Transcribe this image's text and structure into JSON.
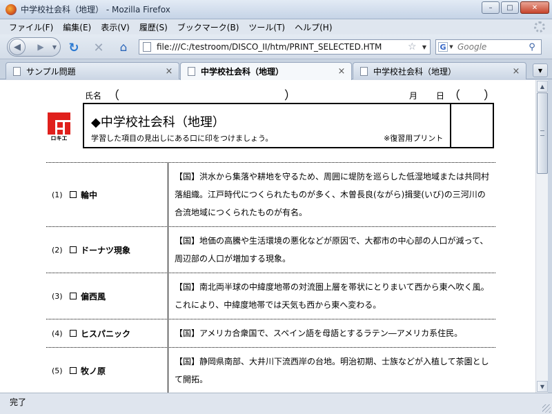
{
  "window": {
    "title": "中学校社会科（地理）  - Mozilla Firefox",
    "buttons": [
      "–",
      "□",
      "✕"
    ]
  },
  "menu": [
    "ファイル(F)",
    "編集(E)",
    "表示(V)",
    "履歴(S)",
    "ブックマーク(B)",
    "ツール(T)",
    "ヘルプ(H)"
  ],
  "nav": {
    "url": "file:///C:/testroom/DISCO_II/htm/PRINT_SELECTED.HTM",
    "search_placeholder": "Google",
    "search_engine_glyph": "G",
    "icons": [
      "back-icon",
      "forward-icon",
      "reload-icon",
      "stop-icon",
      "home-icon",
      "star-icon",
      "search-icon"
    ]
  },
  "tabs": [
    {
      "label": "サンプル問題",
      "close": "×"
    },
    {
      "label": "中学校社会科（地理）",
      "close": "×",
      "active": true
    },
    {
      "label": "中学校社会科（地理）",
      "close": "×"
    }
  ],
  "page": {
    "name_label": "氏名",
    "paren_open": "（",
    "paren_close": "）",
    "month_label": "月",
    "day_label": "日",
    "logo_text": "ロキエ",
    "subject_title": "◆中学校社会科（地理）",
    "instruction": "学習した項目の見出しにある口に印をつけましょう。",
    "review_note": "※復習用プリント",
    "terms": [
      {
        "num": "(1)",
        "word": "輪中",
        "def": "【国】洪水から集落や耕地を守るため、周囲に堤防を巡らした低湿地域または共同村落組織。江戸時代につくられたものが多く、木曽長良(ながら)揖斐(いび)の三河川の合流地域につくられたものが有名。"
      },
      {
        "num": "(2)",
        "word": "ドーナツ現象",
        "def": "【国】地価の高騰や生活環境の悪化などが原因で、大都市の中心部の人口が減って、周辺部の人口が増加する現象。"
      },
      {
        "num": "(3)",
        "word": "偏西風",
        "def": "【国】南北両半球の中緯度地帯の対流圏上層を帯状にとりまいて西から東へ吹く風。これにより、中緯度地帯では天気も西から東へ変わる。"
      },
      {
        "num": "(4)",
        "word": "ヒスパニック",
        "def": "【国】アメリカ合衆国で、スペイン語を母語とするラテン―アメリカ系住民。"
      },
      {
        "num": "(5)",
        "word": "牧ノ原",
        "def": "【国】静岡県南部、大井川下流西岸の台地。明治初期、士族などが入植して茶園として開拓。"
      }
    ]
  },
  "status": "完了",
  "colors": {
    "logo_red": "#e0201c",
    "window_frame": "#c5d3e6"
  }
}
